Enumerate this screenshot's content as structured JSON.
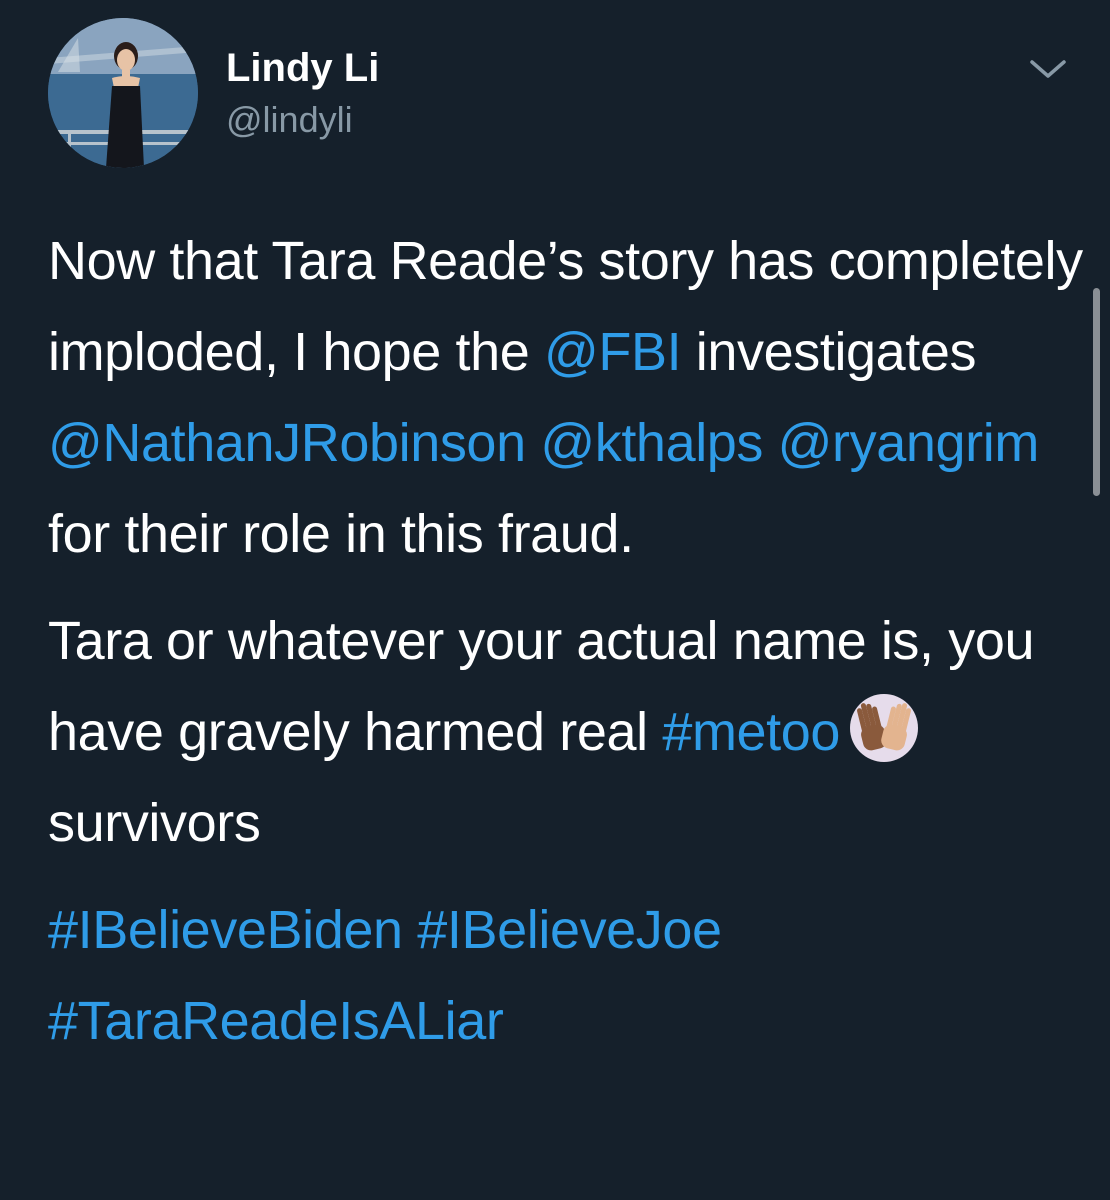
{
  "author": {
    "display_name": "Lindy Li",
    "handle": "@lindyli",
    "avatar_icon": "profile-photo"
  },
  "menu": {
    "icon": "chevron-down-icon"
  },
  "tweet": {
    "p1": {
      "t1": "Now that Tara Reade’s story has completely imploded, I hope the ",
      "m1": "@FBI",
      "t2": " investigates ",
      "m2": "@NathanJRobinson",
      "t3": " ",
      "m3": "@kthalps",
      "t4": " ",
      "m4": "@ryangrim",
      "t5": " for their role in this fraud."
    },
    "p2": {
      "t1": "Tara or whatever your actual name is, you have gravely harmed real ",
      "h1": "#metoo",
      "emoji": "raised-hands-emoji",
      "t2": " survivors"
    },
    "p3": {
      "h1": "#IBelieveBiden",
      "t1": " ",
      "h2": "#IBelieveJoe",
      "t2": " ",
      "h3": "#TaraReadeIsALiar"
    }
  },
  "colors": {
    "background": "#15202b",
    "text": "#ffffff",
    "secondary_text": "#8899a6",
    "link": "#2f9ce8"
  }
}
